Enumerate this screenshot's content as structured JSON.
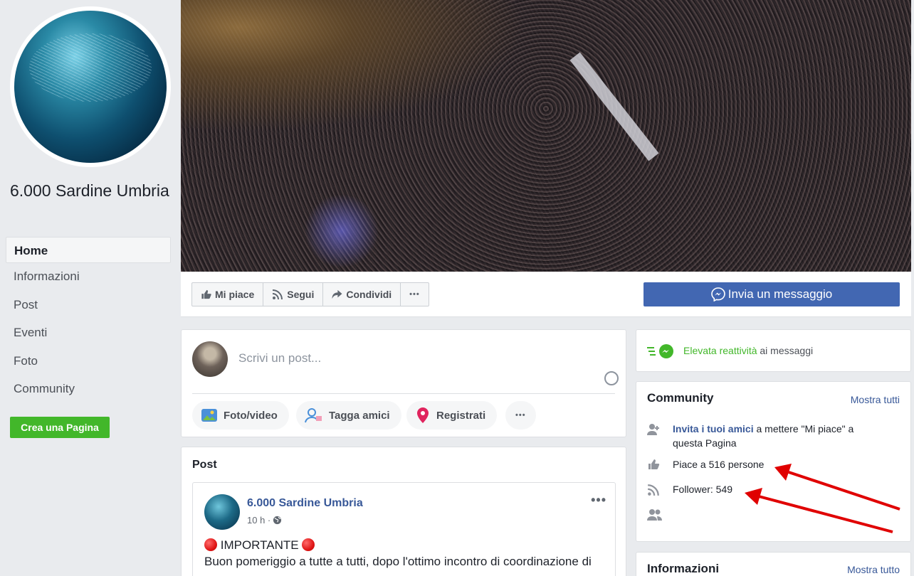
{
  "page": {
    "name": "6.000 Sardine Umbria"
  },
  "nav": {
    "items": [
      {
        "label": "Home"
      },
      {
        "label": "Informazioni"
      },
      {
        "label": "Post"
      },
      {
        "label": "Eventi"
      },
      {
        "label": "Foto"
      },
      {
        "label": "Community"
      }
    ],
    "create_page_label": "Crea una Pagina"
  },
  "actions": {
    "like": "Mi piace",
    "follow": "Segui",
    "share": "Condividi",
    "more": "•••",
    "message": "Invia un messaggio"
  },
  "composer": {
    "placeholder": "Scrivi un post...",
    "photo": "Foto/video",
    "tag": "Tagga amici",
    "checkin": "Registrati",
    "more": "•••"
  },
  "posts": {
    "heading": "Post",
    "item": {
      "author": "6.000 Sardine Umbria",
      "time": "10 h · ",
      "title": "IMPORTANTE",
      "body": "Buon pomeriggio a tutte a tutti, dopo l'ottimo incontro di coordinazione di"
    }
  },
  "responsiveness": {
    "highlight": "Elevata reattività",
    "rest": " ai messaggi"
  },
  "community": {
    "heading": "Community",
    "see_all": "Mostra tutti",
    "invite_link": "Invita i tuoi amici",
    "invite_rest": " a mettere \"Mi piace\" a questa Pagina",
    "likes": "Piace a 516 persone",
    "followers": "Follower: 549"
  },
  "info": {
    "heading": "Informazioni",
    "see_all": "Mostra tutto"
  },
  "colors": {
    "brand": "#4267b2",
    "link": "#385898",
    "green": "#42b72a",
    "annotation": "#e00000"
  }
}
